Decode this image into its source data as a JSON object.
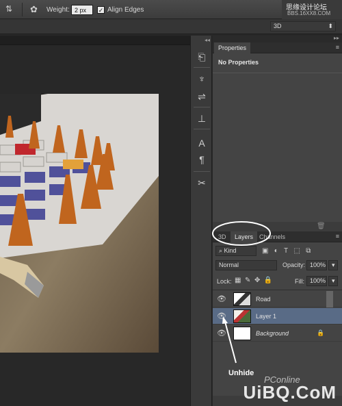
{
  "options_bar": {
    "weight_label": "Weight:",
    "weight_value": "2 px",
    "align_edges_label": "Align Edges",
    "align_edges_checked": true,
    "workspace_value": "3D",
    "site_mark_top": "思缘设计论坛",
    "site_mark_url": "BBS.16XX8.COM"
  },
  "toolstrip": {
    "icons": [
      "history-icon",
      "brush-presets-icon",
      "tool-presets-icon",
      "clone-source-icon",
      "character-icon",
      "paragraph-icon",
      "tools-icon"
    ]
  },
  "properties_panel": {
    "tab": "Properties",
    "message": "No Properties"
  },
  "layers_panel": {
    "tabs": [
      "3D",
      "Layers",
      "Channels"
    ],
    "active_tab": "Layers",
    "filter_kind": "Kind",
    "blend_mode": "Normal",
    "opacity_label": "Opacity:",
    "opacity_value": "100%",
    "lock_label": "Lock:",
    "fill_label": "Fill:",
    "fill_value": "100%",
    "layers": [
      {
        "name": "Road",
        "visible": true,
        "selected": false
      },
      {
        "name": "Layer 1",
        "visible": true,
        "selected": true
      },
      {
        "name": "Background",
        "visible": true,
        "selected": false,
        "locked": true
      }
    ]
  },
  "annotation": {
    "label": "Unhide"
  },
  "watermark": {
    "text": "UiBQ.CoM",
    "pconline": "PConline"
  },
  "colors": {
    "panel_bg": "#444444",
    "selected_row": "#596b86",
    "annotation_stroke": "#ffffff"
  }
}
